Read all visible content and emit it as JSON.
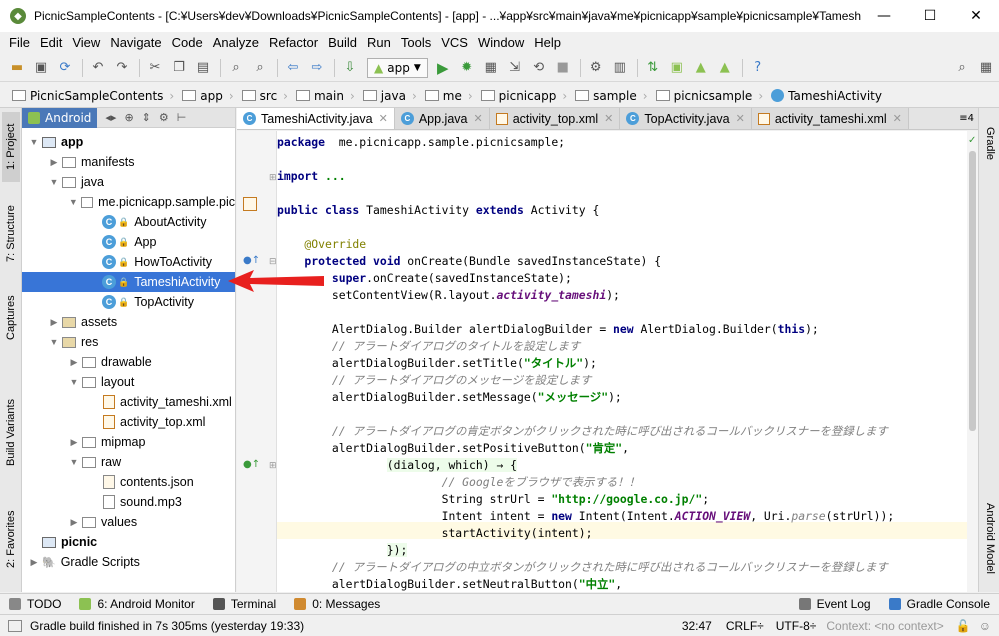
{
  "window": {
    "title": "PicnicSampleContents - [C:¥Users¥dev¥Downloads¥PicnicSampleContents] - [app] - ...¥app¥src¥main¥java¥me¥picnicapp¥sample¥picnicsample¥TameshiAc...",
    "minimize": "—",
    "maximize": "☐",
    "close": "✕"
  },
  "menu": [
    "File",
    "Edit",
    "View",
    "Navigate",
    "Code",
    "Analyze",
    "Refactor",
    "Build",
    "Run",
    "Tools",
    "VCS",
    "Window",
    "Help"
  ],
  "toolbar": {
    "run_config": "app"
  },
  "breadcrumbs": [
    "PicnicSampleContents",
    "app",
    "src",
    "main",
    "java",
    "me",
    "picnicapp",
    "sample",
    "picnicsample",
    "TameshiActivity"
  ],
  "project_panel": {
    "view_selector": "Android",
    "tree": [
      {
        "label": "app",
        "level": 0,
        "icon": "folder-module",
        "expanded": true
      },
      {
        "label": "manifests",
        "level": 1,
        "icon": "folder",
        "expanded": false
      },
      {
        "label": "java",
        "level": 1,
        "icon": "folder",
        "expanded": true
      },
      {
        "label": "me.picnicapp.sample.pic",
        "level": 2,
        "icon": "package",
        "expanded": true
      },
      {
        "label": "AboutActivity",
        "level": 3,
        "icon": "class"
      },
      {
        "label": "App",
        "level": 3,
        "icon": "class"
      },
      {
        "label": "HowToActivity",
        "level": 3,
        "icon": "class"
      },
      {
        "label": "TameshiActivity",
        "level": 3,
        "icon": "class",
        "selected": true
      },
      {
        "label": "TopActivity",
        "level": 3,
        "icon": "class"
      },
      {
        "label": "assets",
        "level": 1,
        "icon": "folder-res",
        "expanded": false
      },
      {
        "label": "res",
        "level": 1,
        "icon": "folder-res",
        "expanded": true
      },
      {
        "label": "drawable",
        "level": 2,
        "icon": "folder",
        "expanded": false
      },
      {
        "label": "layout",
        "level": 2,
        "icon": "folder",
        "expanded": true
      },
      {
        "label": "activity_tameshi.xml",
        "level": 3,
        "icon": "xml"
      },
      {
        "label": "activity_top.xml",
        "level": 3,
        "icon": "xml"
      },
      {
        "label": "mipmap",
        "level": 2,
        "icon": "folder",
        "expanded": false
      },
      {
        "label": "raw",
        "level": 2,
        "icon": "folder",
        "expanded": true
      },
      {
        "label": "contents.json",
        "level": 3,
        "icon": "json"
      },
      {
        "label": "sound.mp3",
        "level": 3,
        "icon": "file"
      },
      {
        "label": "values",
        "level": 2,
        "icon": "folder",
        "expanded": false
      },
      {
        "label": "picnic",
        "level": 0,
        "icon": "folder-module",
        "expanded": null
      },
      {
        "label": "Gradle Scripts",
        "level": 0,
        "icon": "gradle",
        "expanded": false
      }
    ]
  },
  "left_tool_tabs": [
    "1: Project",
    "7: Structure",
    "Captures",
    "Build Variants",
    "2: Favorites"
  ],
  "right_tool_tabs": [
    "Gradle",
    "Android Model"
  ],
  "editor_tabs": [
    {
      "label": "TameshiActivity.java",
      "icon": "class",
      "active": true
    },
    {
      "label": "App.java",
      "icon": "class",
      "active": false
    },
    {
      "label": "activity_top.xml",
      "icon": "xml",
      "active": false
    },
    {
      "label": "TopActivity.java",
      "icon": "class",
      "active": false
    },
    {
      "label": "activity_tameshi.xml",
      "icon": "xml",
      "active": false
    }
  ],
  "editor_tab_overflow": "≡4",
  "code_lines": [
    [
      [
        "kw",
        "package"
      ],
      [
        "",
        "  me.picnicapp.sample.picnicsample;"
      ]
    ],
    [],
    [
      [
        "kw",
        "import"
      ],
      [
        "",
        ""
      ],
      [
        "st",
        " ..."
      ]
    ],
    [],
    [
      [
        "kw",
        "public class"
      ],
      [
        "",
        " TameshiActivity "
      ],
      [
        "kw",
        "extends"
      ],
      [
        "",
        " Activity {"
      ]
    ],
    [],
    [
      [
        "an",
        "    @Override"
      ]
    ],
    [
      [
        "kw",
        "    protected void"
      ],
      [
        "",
        " onCreate(Bundle savedInstanceState) {"
      ]
    ],
    [
      [
        "kw",
        "        super"
      ],
      [
        "",
        ".onCreate(savedInstanceState);"
      ]
    ],
    [
      [
        "",
        "        setContentView(R.layout."
      ],
      [
        "fd",
        "activity_tameshi"
      ],
      [
        "",
        ");"
      ]
    ],
    [],
    [
      [
        "",
        "        AlertDialog.Builder alertDialogBuilder = "
      ],
      [
        "kw",
        "new"
      ],
      [
        "",
        " AlertDialog.Builder("
      ],
      [
        "kw",
        "this"
      ],
      [
        "",
        ");"
      ]
    ],
    [
      [
        "cm",
        "        // アラートダイアログのタイトルを設定します"
      ]
    ],
    [
      [
        "",
        "        alertDialogBuilder.setTitle("
      ],
      [
        "st",
        "\"タイトル\""
      ],
      [
        "",
        ");"
      ]
    ],
    [
      [
        "cm",
        "        // アラートダイアログのメッセージを設定します"
      ]
    ],
    [
      [
        "",
        "        alertDialogBuilder.setMessage("
      ],
      [
        "st",
        "\"メッセージ\""
      ],
      [
        "",
        ");"
      ]
    ],
    [],
    [
      [
        "cm",
        "        // アラートダイアログの肯定ボタンがクリックされた時に呼び出されるコールバックリスナーを登録します"
      ]
    ],
    [
      [
        "",
        "        alertDialogBuilder.setPositiveButton("
      ],
      [
        "st",
        "\"肯定\""
      ],
      [
        "",
        ","
      ]
    ],
    [
      [
        "",
        "                "
      ],
      [
        "lam",
        "(dialog, which) → {"
      ]
    ],
    [
      [
        "",
        "                        "
      ],
      [
        "cm",
        "// Googleをブラウザで表示する！！"
      ]
    ],
    [
      [
        "",
        "                        String strUrl = "
      ],
      [
        "st",
        "\"http://google.co.jp/\""
      ],
      [
        "",
        ";"
      ]
    ],
    [
      [
        "",
        "                        Intent intent = "
      ],
      [
        "kw",
        "new"
      ],
      [
        "",
        " Intent(Intent."
      ],
      [
        "fd",
        "ACTION_VIEW"
      ],
      [
        "",
        ", Uri."
      ],
      [
        "cm",
        "parse"
      ],
      [
        "",
        "(strUrl));"
      ]
    ],
    [
      [
        "",
        "                        startActivity(intent);"
      ]
    ],
    [
      [
        "",
        "                "
      ],
      [
        "lam",
        "});"
      ]
    ],
    [
      [
        "cm",
        "        // アラートダイアログの中立ボタンがクリックされた時に呼び出されるコールバックリスナーを登録します"
      ]
    ],
    [
      [
        "",
        "        alertDialogBuilder.setNeutralButton("
      ],
      [
        "st",
        "\"中立\""
      ],
      [
        "",
        ","
      ]
    ]
  ],
  "tool_windows": [
    {
      "label": "TODO",
      "icon": "todo-icon"
    },
    {
      "label": "6: Android Monitor",
      "icon": "android-icon"
    },
    {
      "label": "Terminal",
      "icon": "terminal-icon"
    },
    {
      "label": "0: Messages",
      "icon": "messages-icon"
    },
    {
      "label": "Event Log",
      "icon": "event-log-icon"
    },
    {
      "label": "Gradle Console",
      "icon": "gradle-console-icon"
    }
  ],
  "status": {
    "message": "Gradle build finished in 7s 305ms (yesterday 19:33)",
    "position": "32:47",
    "line_sep": "CRLF÷",
    "encoding": "UTF-8÷",
    "context": "Context: <no context>"
  },
  "colors": {
    "selection": "#3875d7",
    "arrow": "#e8201e",
    "panel_header": "#4a78b8"
  }
}
